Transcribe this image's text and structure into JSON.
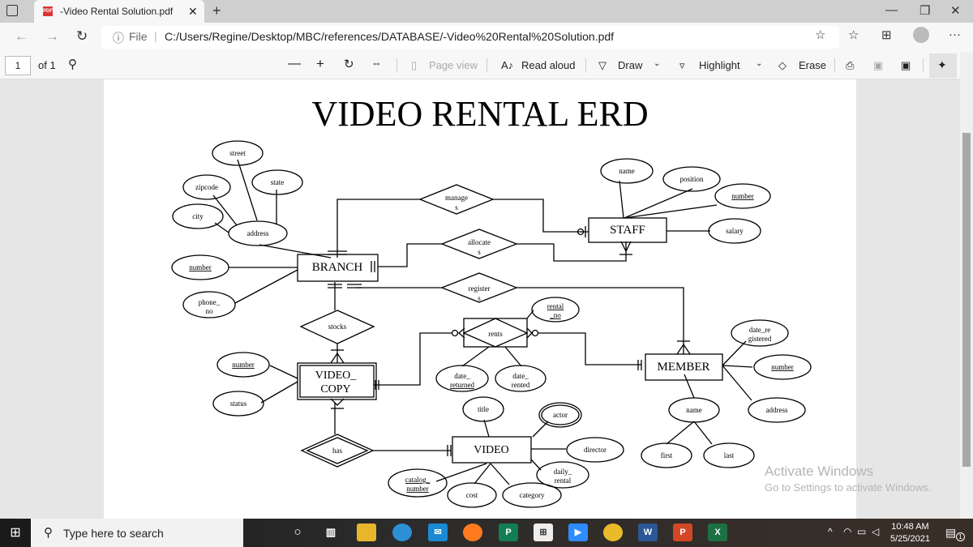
{
  "browser": {
    "tab_title": "-Video Rental Solution.pdf",
    "address_prefix": "File",
    "url": "C:/Users/Regine/Desktop/MBC/references/DATABASE/-Video%20Rental%20Solution.pdf"
  },
  "pdf_toolbar": {
    "page_number": "1",
    "page_total": "of 1",
    "page_view": "Page view",
    "read_aloud": "Read aloud",
    "draw": "Draw",
    "highlight": "Highlight",
    "erase": "Erase"
  },
  "erd": {
    "title": "VIDEO RENTAL ERD",
    "entities": {
      "branch": "BRANCH",
      "staff": "STAFF",
      "member": "MEMBER",
      "video_copy_1": "VIDEO_",
      "video_copy_2": "COPY",
      "video": "VIDEO"
    },
    "relationships": {
      "manages_1": "manage",
      "manages_2": "s",
      "allocates_1": "allocate",
      "allocates_2": "s",
      "registers_1": "register",
      "registers_2": "s",
      "stocks": "stocks",
      "rents": "rents",
      "has": "has"
    },
    "attributes": {
      "street": "street",
      "state": "state",
      "zipcode": "zipcode",
      "city": "city",
      "address": "address",
      "branch_number": "number",
      "phone_1": "phone_",
      "phone_2": "no",
      "staff_name": "name",
      "position": "position",
      "staff_number": "number",
      "salary": "salary",
      "rental_1": "rental",
      "rental_2": "_no",
      "date_reg_1": "date_re",
      "date_reg_2": "gistered",
      "member_number": "number",
      "member_address": "address",
      "member_name": "name",
      "first": "first",
      "last": "last",
      "copy_number": "number",
      "status": "status",
      "date_ret_1": "date_",
      "date_ret_2": "returned",
      "date_rent_1": "date_",
      "date_rent_2": "rented",
      "title": "title",
      "actor": "actor",
      "director": "director",
      "daily_1": "daily_",
      "daily_2": "rental",
      "catalog_1": "catalog_",
      "catalog_2": "number",
      "cost": "cost",
      "category": "category"
    }
  },
  "watermark": {
    "line1": "Activate Windows",
    "line2": "Go to Settings to activate Windows."
  },
  "taskbar": {
    "search_placeholder": "Type here to search",
    "time": "10:48 AM",
    "date": "5/25/2021",
    "notifications": "1"
  }
}
